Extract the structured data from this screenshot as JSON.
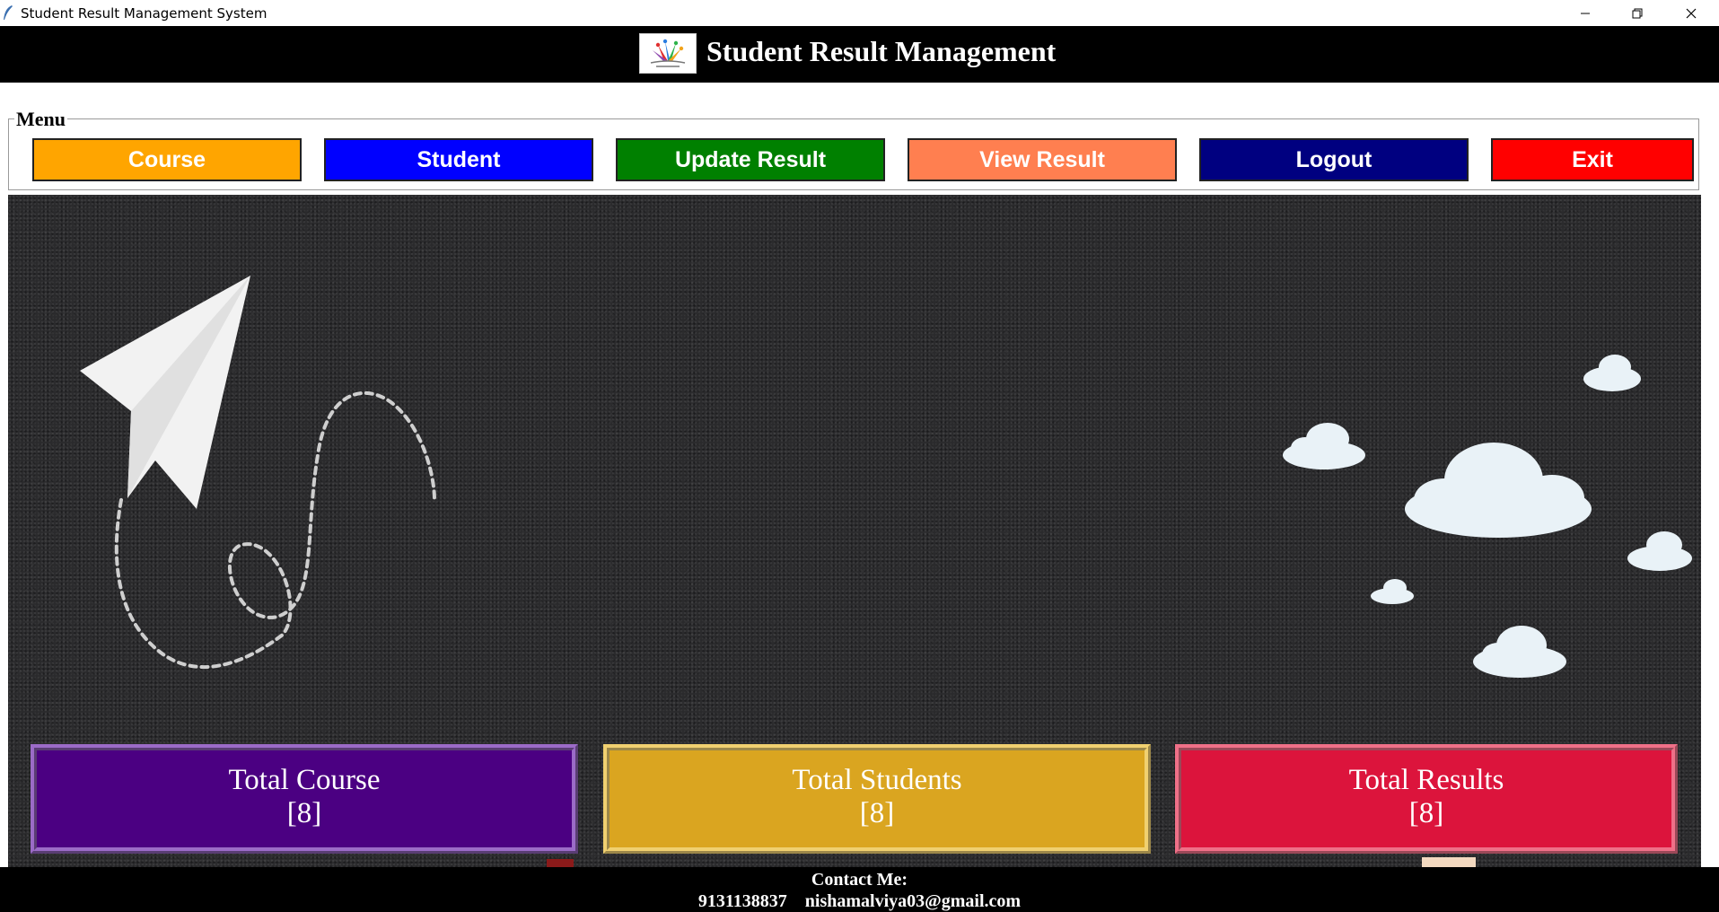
{
  "window": {
    "title": "Student Result Management System"
  },
  "header": {
    "app_title": "Student Result Management"
  },
  "menu": {
    "legend": "Menu",
    "buttons": [
      {
        "label": "Course",
        "color": "#FFA500"
      },
      {
        "label": "Student",
        "color": "#0000FF"
      },
      {
        "label": "Update Result",
        "color": "#008000"
      },
      {
        "label": "View Result",
        "color": "#FF7F50"
      },
      {
        "label": "Logout",
        "color": "#000080"
      },
      {
        "label": "Exit",
        "color": "#FF0000"
      }
    ]
  },
  "stats": [
    {
      "label": "Total Course",
      "value": "[8]",
      "color": "#4B0082"
    },
    {
      "label": "Total Students",
      "value": "[8]",
      "color": "#DAA520"
    },
    {
      "label": "Total Results",
      "value": "[8]",
      "color": "#DC143C"
    }
  ],
  "footer": {
    "line1": "Contact Me:",
    "line2": "9131138837    nishamalviya03@gmail.com"
  }
}
